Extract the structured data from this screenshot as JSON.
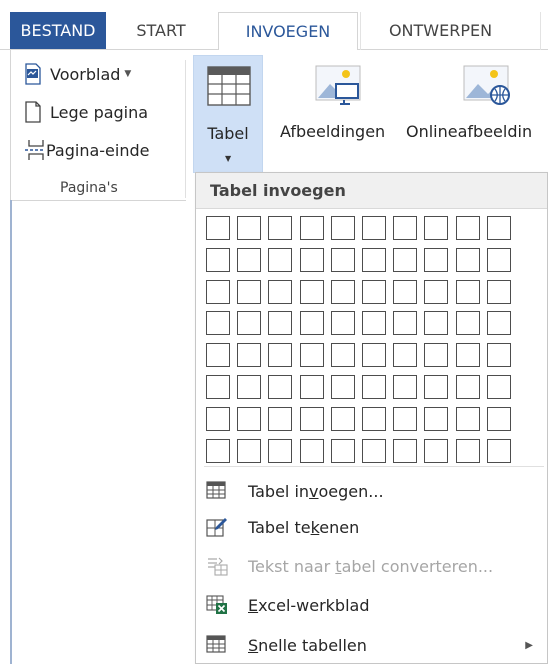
{
  "tabs": [
    {
      "label": "BESTAND"
    },
    {
      "label": "START"
    },
    {
      "label": "INVOEGEN"
    },
    {
      "label": "ONTWERPEN"
    }
  ],
  "ribbon": {
    "pages_group": {
      "items": [
        {
          "label": "Voorblad",
          "has_dropdown": true,
          "icon": "cover-page-icon"
        },
        {
          "label": "Lege pagina",
          "icon": "blank-page-icon"
        },
        {
          "label": "Pagina-einde",
          "icon": "page-break-icon"
        }
      ],
      "group_label": "Pagina's"
    },
    "table_button": {
      "label": "Tabel",
      "icon": "table-icon"
    },
    "pictures_button": {
      "label": "Afbeeldingen",
      "icon": "picture-icon"
    },
    "online_pictures_button": {
      "label": "Onlineafbeeldin",
      "icon": "online-picture-icon"
    }
  },
  "dropdown": {
    "header": "Tabel invoegen",
    "grid": {
      "columns": 10,
      "rows": 8
    },
    "items": [
      {
        "pre": "Tabel in",
        "key": "v",
        "post": "oegen...",
        "disabled": false,
        "icon": "insert-table-icon"
      },
      {
        "pre": "Tabel te",
        "key": "k",
        "post": "enen",
        "disabled": false,
        "icon": "draw-table-icon"
      },
      {
        "pre": "Tekst naar ",
        "key": "t",
        "post": "abel converteren...",
        "disabled": true,
        "icon": "convert-text-icon"
      },
      {
        "pre": "",
        "key": "E",
        "post": "xcel-werkblad",
        "disabled": false,
        "icon": "excel-icon"
      },
      {
        "pre": "",
        "key": "S",
        "post": "nelle tabellen",
        "disabled": false,
        "icon": "quick-tables-icon",
        "submenu": true
      }
    ]
  },
  "colors": {
    "file_tab": "#2b579a",
    "active_tab_text": "#2b579a",
    "table_button_highlight": "#cfe0f6",
    "excel_green": "#217346"
  }
}
